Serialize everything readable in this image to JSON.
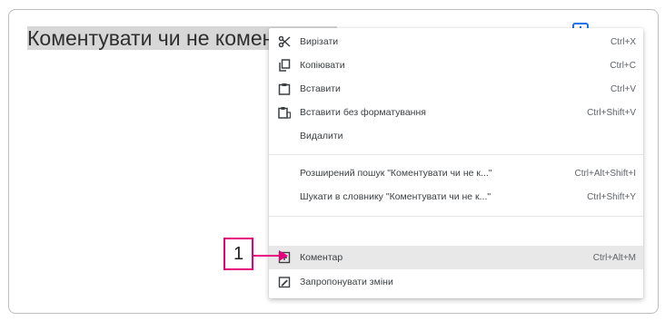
{
  "document": {
    "text_before_selection": "",
    "selected_text": "Коментувати чи не коментувати"
  },
  "menu": {
    "items": [
      {
        "label": "Вирізати",
        "shortcut": "Ctrl+X",
        "icon": "scissors-icon"
      },
      {
        "label": "Копіювати",
        "shortcut": "Ctrl+C",
        "icon": "copy-icon"
      },
      {
        "label": "Вставити",
        "shortcut": "Ctrl+V",
        "icon": "clipboard-icon"
      },
      {
        "label": "Вставити без форматування",
        "shortcut": "Ctrl+Shift+V",
        "icon": "paste-plain-icon"
      },
      {
        "label": "Видалити",
        "shortcut": "",
        "icon": ""
      },
      {
        "label": "Розширений пошук \"Коментувати чи не к...\"",
        "shortcut": "Ctrl+Alt+Shift+I",
        "icon": ""
      },
      {
        "label": "Шукати в словнику \"Коментувати чи не к...\"",
        "shortcut": "Ctrl+Shift+Y",
        "icon": ""
      },
      {
        "label": "Коментар",
        "shortcut": "Ctrl+Alt+M",
        "icon": "add-comment-icon",
        "highlighted": true
      },
      {
        "label": "Запропонувати зміни",
        "shortcut": "",
        "icon": "suggest-edits-icon"
      }
    ]
  },
  "callout": {
    "number": "1"
  },
  "colors": {
    "accent": "#1a73e8",
    "callout": "#e4007c",
    "highlight": "#e8e8e8"
  }
}
